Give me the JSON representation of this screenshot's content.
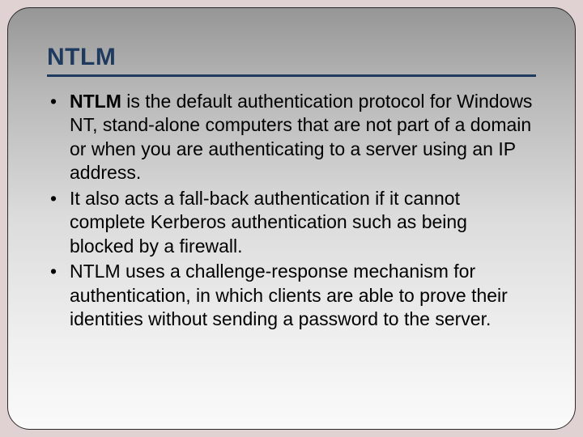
{
  "slide": {
    "title": "NTLM",
    "bullets": [
      {
        "bold_lead": "NTLM",
        "rest": " is the default authentication protocol for Windows NT, stand-alone computers that are not part of a domain or when you are authenticating to a server using an IP address."
      },
      {
        "bold_lead": "",
        "rest": "It also acts a fall-back authentication if it cannot complete Kerberos authentication such as being blocked by a firewall."
      },
      {
        "bold_lead": "",
        "rest": "NTLM uses a challenge-response mechanism for authentication, in which clients are able to prove their identities without sending a password to the server."
      }
    ],
    "bullet_marker": "•"
  }
}
